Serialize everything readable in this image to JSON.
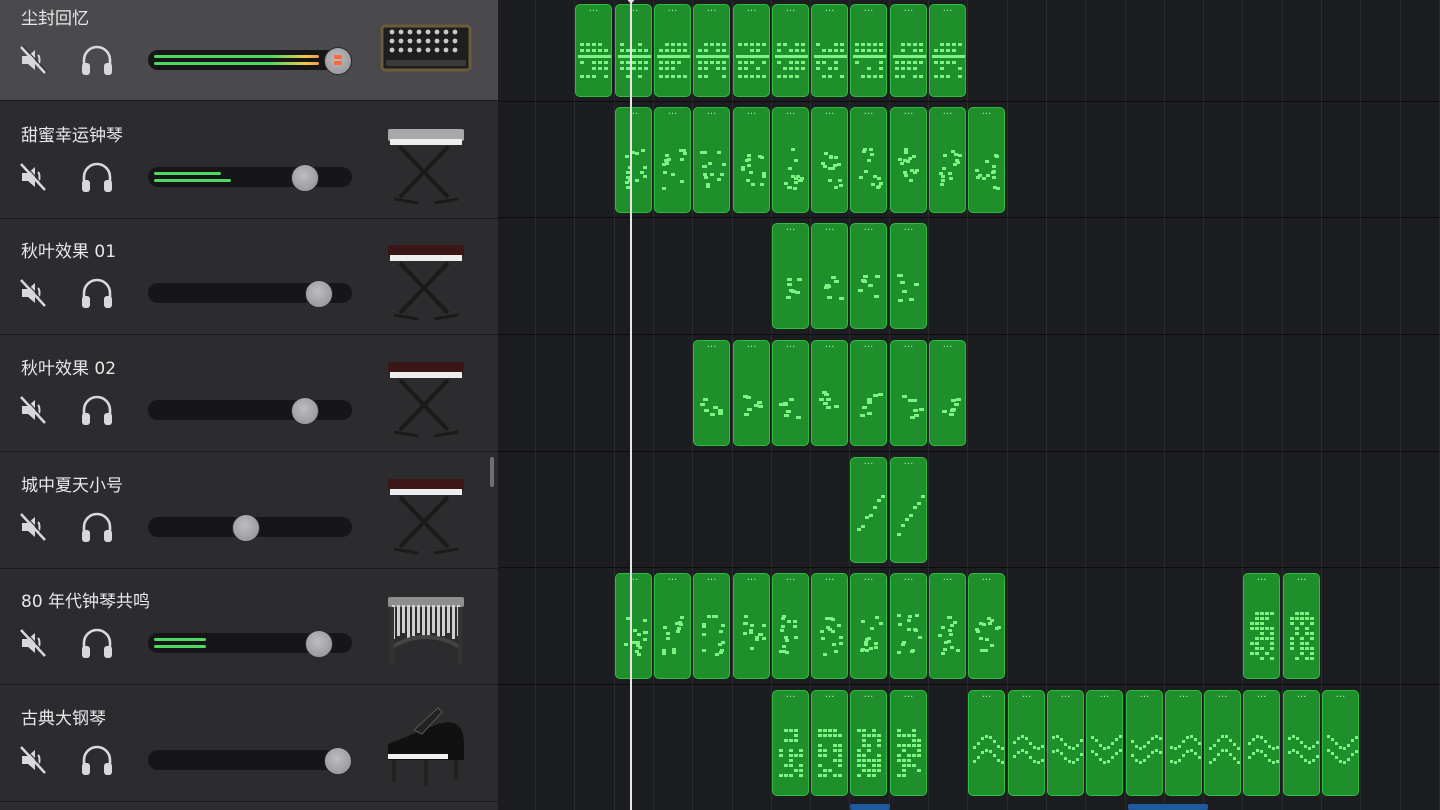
{
  "tracks": [
    {
      "name": "尘封回忆",
      "selected": true,
      "volume": 0.93,
      "meter": [
        0.86,
        0.86
      ],
      "instrument": "analog-synth-icon",
      "clipping": true
    },
    {
      "name": "甜蜜幸运钟琴",
      "selected": false,
      "volume": 0.77,
      "meter": [
        0.35,
        0.4
      ],
      "instrument": "electronic-keyboard-stand-icon",
      "clipping": false
    },
    {
      "name": "秋叶效果 01",
      "selected": false,
      "volume": 0.84,
      "meter": [
        0,
        0
      ],
      "instrument": "synth-keyboard-stand-icon",
      "clipping": false
    },
    {
      "name": "秋叶效果 02",
      "selected": false,
      "volume": 0.77,
      "meter": [
        0,
        0
      ],
      "instrument": "synth-keyboard-stand-icon",
      "clipping": false
    },
    {
      "name": "城中夏天小号",
      "selected": false,
      "volume": 0.48,
      "meter": [
        0,
        0
      ],
      "instrument": "synth-keyboard-stand-icon",
      "clipping": false
    },
    {
      "name": "80 年代钟琴共鸣",
      "selected": false,
      "volume": 0.84,
      "meter": [
        0.27,
        0.27
      ],
      "instrument": "vibraphone-icon",
      "clipping": false
    },
    {
      "name": "古典大钢琴",
      "selected": false,
      "volume": 0.93,
      "meter": [
        0,
        0
      ],
      "instrument": "grand-piano-icon",
      "clipping": false
    }
  ],
  "regions": [
    {
      "track": 0,
      "from": 1,
      "to": 10,
      "pattern": "dense"
    },
    {
      "track": 1,
      "from": 2,
      "to": 11,
      "pattern": "scatter"
    },
    {
      "track": 2,
      "from": 6,
      "to": 9,
      "pattern": "sparse"
    },
    {
      "track": 3,
      "from": 4,
      "to": 10,
      "pattern": "sparse"
    },
    {
      "track": 4,
      "from": 8,
      "to": 9,
      "pattern": "steps"
    },
    {
      "track": 5,
      "from": 2,
      "to": 11,
      "pattern": "scatter"
    },
    {
      "track": 5,
      "from": 18,
      "to": 19,
      "pattern": "chord"
    },
    {
      "track": 6,
      "from": 6,
      "to": 9,
      "pattern": "chord"
    },
    {
      "track": 6,
      "from": 11,
      "to": 20,
      "pattern": "wave"
    }
  ],
  "region_label": "···",
  "colors": {
    "region_fill": "#1f8f2b",
    "region_border": "#2ebd3e",
    "note": "#7cf484",
    "meter_green": "#4cd964",
    "clip": "#ff6a3c"
  }
}
